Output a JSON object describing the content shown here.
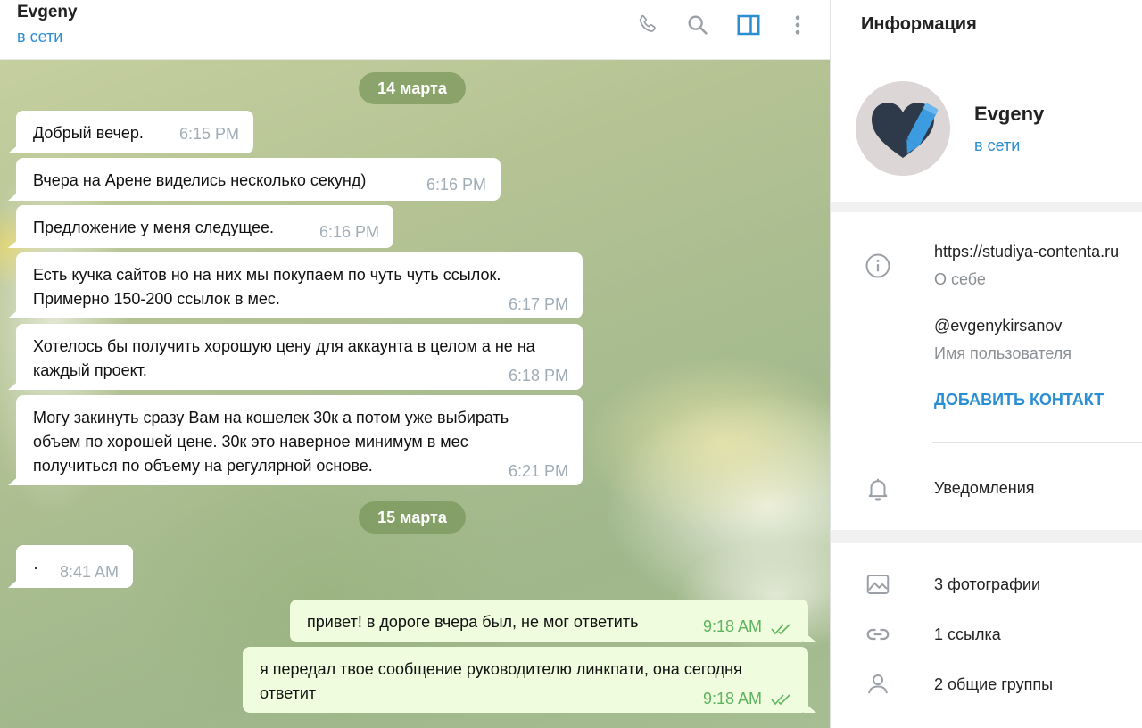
{
  "chat_header": {
    "peer_name": "Evgeny",
    "peer_status": "в сети"
  },
  "header_icons": [
    "phone-icon",
    "search-icon",
    "sidebar-toggle-icon",
    "more-vertical-icon"
  ],
  "colors": {
    "accent": "#2a8ed2",
    "outgoing_bubble": "#effdde",
    "outgoing_time": "#5eb35e",
    "incoming_time": "#a0acb6",
    "date_pill": "#7a965a"
  },
  "dates": [
    "14 марта",
    "15 марта"
  ],
  "messages": [
    {
      "text": "Добрый вечер.",
      "time": "6:15 PM",
      "direction": "in"
    },
    {
      "text": "Вчера на Арене виделись несколько секунд)",
      "time": "6:16 PM",
      "direction": "in"
    },
    {
      "text": "Предложение у меня следущее.",
      "time": "6:16 PM",
      "direction": "in"
    },
    {
      "text": "Есть кучка сайтов но на них мы покупаем по чуть чуть ссылок. Примерно 150-200 ссылок в мес.",
      "time": "6:17 PM",
      "direction": "in"
    },
    {
      "text": "Хотелось бы получить хорошую цену для аккаунта в целом а не на каждый проект.",
      "time": "6:18 PM",
      "direction": "in"
    },
    {
      "text": "Могу закинуть сразу Вам на кошелек 30к а потом уже выбирать объем по хорошей цене. 30к это наверное минимум в мес получиться по объему на регулярной основе.",
      "time": "6:21 PM",
      "direction": "in"
    },
    {
      "text": "·",
      "time": "8:41 AM",
      "direction": "in"
    },
    {
      "text": "привет! в дороге вчера был, не мог ответить",
      "time": "9:18 AM",
      "direction": "out",
      "read": true
    },
    {
      "text": "я передал твое сообщение руководителю линкпати, она сегодня ответит",
      "time": "9:18 AM",
      "direction": "out",
      "read": true
    }
  ],
  "info_panel": {
    "title": "Информация",
    "name": "Evgeny",
    "status": "в сети",
    "bio_value": "https://studiya-contenta.ru",
    "bio_label": "О себе",
    "username_value": "@evgenykirsanov",
    "username_label": "Имя пользователя",
    "add_contact": "ДОБАВИТЬ КОНТАКТ",
    "notifications": "Уведомления",
    "photos": "3 фотографии",
    "links": "1 ссылка",
    "groups": "2 общие группы"
  }
}
